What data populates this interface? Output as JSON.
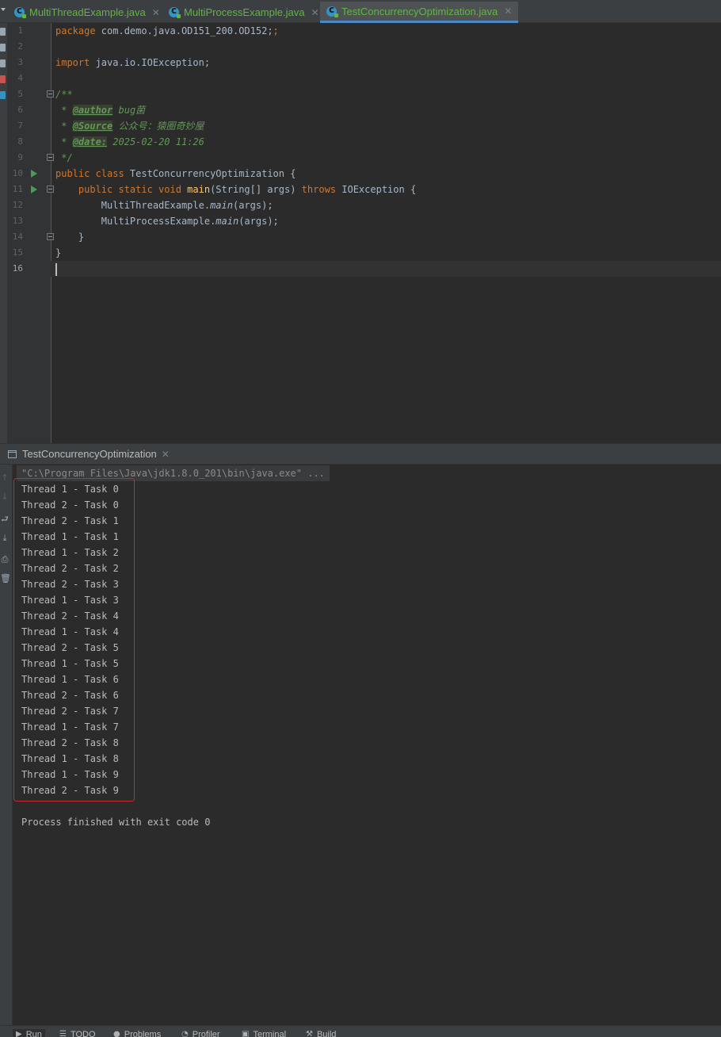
{
  "tabs": [
    {
      "label": "MultiThreadExample.java",
      "active": false
    },
    {
      "label": "MultiProcessExample.java",
      "active": false
    },
    {
      "label": "TestConcurrencyOptimization.java",
      "active": true
    }
  ],
  "editor": {
    "line_numbers": [
      "1",
      "2",
      "3",
      "4",
      "5",
      "6",
      "7",
      "8",
      "9",
      "10",
      "11",
      "12",
      "13",
      "14",
      "15",
      "16"
    ],
    "code": {
      "l1_kw": "package",
      "l1_rest": " com.demo.java.OD151_200.OD152;",
      "l3_kw": "import",
      "l3_rest": " java.io.IOException;",
      "l5": "/**",
      "l6_pre": " * ",
      "l6_tag": "@author",
      "l6_val": " bug菌",
      "l7_pre": " * ",
      "l7_tag": "@Source",
      "l7_val": " 公众号：猿圈奇妙屋",
      "l8_pre": " * ",
      "l8_tag": "@date:",
      "l8_val": " 2025-02-20 11:26",
      "l9": " */",
      "l10_kw": "public class",
      "l10_rest": " TestConcurrencyOptimization {",
      "l11_indent": "    ",
      "l11_kw1": "public static void",
      "l11_fn": " main",
      "l11_mid": "(String[] args) ",
      "l11_kw2": "throws",
      "l11_rest": " IOException {",
      "l12_pre": "        MultiThreadExample.",
      "l12_it": "main",
      "l12_post": "(args);",
      "l13_pre": "        MultiProcessExample.",
      "l13_it": "main",
      "l13_post": "(args);",
      "l14": "    }",
      "l15": "}"
    }
  },
  "run_panel": {
    "title": "TestConcurrencyOptimization",
    "command": "\"C:\\Program Files\\Java\\jdk1.8.0_201\\bin\\java.exe\" ...",
    "output": [
      "Thread 1 - Task 0",
      "Thread 2 - Task 0",
      "Thread 2 - Task 1",
      "Thread 1 - Task 1",
      "Thread 1 - Task 2",
      "Thread 2 - Task 2",
      "Thread 2 - Task 3",
      "Thread 1 - Task 3",
      "Thread 2 - Task 4",
      "Thread 1 - Task 4",
      "Thread 2 - Task 5",
      "Thread 1 - Task 5",
      "Thread 1 - Task 6",
      "Thread 2 - Task 6",
      "Thread 2 - Task 7",
      "Thread 1 - Task 7",
      "Thread 2 - Task 8",
      "Thread 1 - Task 8",
      "Thread 1 - Task 9",
      "Thread 2 - Task 9"
    ],
    "finish": "Process finished with exit code 0"
  },
  "bottom_bar": {
    "run": "Run",
    "todo": "TODO",
    "problems": "Problems",
    "profiler": "Profiler",
    "terminal": "Terminal",
    "build": "Build"
  },
  "colors": {
    "keyword": "#cc7832",
    "comment": "#629755",
    "highlight_box": "#c9282d",
    "tab_text": "#62b543",
    "active_tab_underline": "#4a88c7"
  }
}
